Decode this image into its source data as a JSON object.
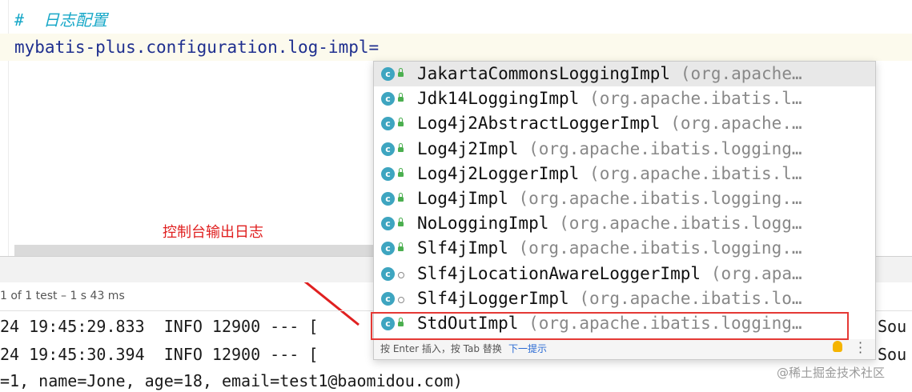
{
  "editor": {
    "comment": "#  日志配置",
    "code": "mybatis-plus.configuration.log-impl="
  },
  "annotation": {
    "label": "控制台输出日志",
    "color": "#e02020"
  },
  "run_panel": {
    "test_status": "1 of 1 test – 1 s 43 ms",
    "log_lines": [
      "24 19:45:29.833  INFO 12900 --- [",
      "24 19:45:30.394  INFO 12900 --- [",
      "=1, name=Jone, age=18, email=test1@baomidou.com)"
    ],
    "log_right": [
      "Sou",
      "Sou"
    ]
  },
  "completion": {
    "items": [
      {
        "name": "JakartaCommonsLoggingImpl",
        "package": "(org.apache…",
        "icon": "class-icon",
        "visibility": "public"
      },
      {
        "name": "Jdk14LoggingImpl",
        "package": "(org.apache.ibatis.l…",
        "icon": "class-icon",
        "visibility": "public"
      },
      {
        "name": "Log4j2AbstractLoggerImpl",
        "package": "(org.apache.…",
        "icon": "class-icon",
        "visibility": "public"
      },
      {
        "name": "Log4j2Impl",
        "package": "(org.apache.ibatis.logging…",
        "icon": "class-icon",
        "visibility": "public"
      },
      {
        "name": "Log4j2LoggerImpl",
        "package": "(org.apache.ibatis.l…",
        "icon": "class-icon",
        "visibility": "public"
      },
      {
        "name": "Log4jImpl",
        "package": "(org.apache.ibatis.logging.…",
        "icon": "class-icon",
        "visibility": "public"
      },
      {
        "name": "NoLoggingImpl",
        "package": "(org.apache.ibatis.logg…",
        "icon": "class-icon",
        "visibility": "public"
      },
      {
        "name": "Slf4jImpl",
        "package": "(org.apache.ibatis.logging.…",
        "icon": "class-icon",
        "visibility": "public"
      },
      {
        "name": "Slf4jLocationAwareLoggerImpl",
        "package": "(org.apa…",
        "icon": "class-icon",
        "visibility": "package"
      },
      {
        "name": "Slf4jLoggerImpl",
        "package": "(org.apache.ibatis.lo…",
        "icon": "class-icon",
        "visibility": "package"
      },
      {
        "name": "StdOutImpl",
        "package": "(org.apache.ibatis.logging…",
        "icon": "class-icon",
        "visibility": "public"
      }
    ],
    "footer_hint": "按 Enter 插入，按 Tab 替换",
    "footer_link": "下一提示"
  },
  "watermark": "@稀土掘金技术社区",
  "colors": {
    "comment": "#18a8c8",
    "code": "#1f2f8f",
    "highlight": "#e53935",
    "class_icon": "#3ea5c0"
  }
}
